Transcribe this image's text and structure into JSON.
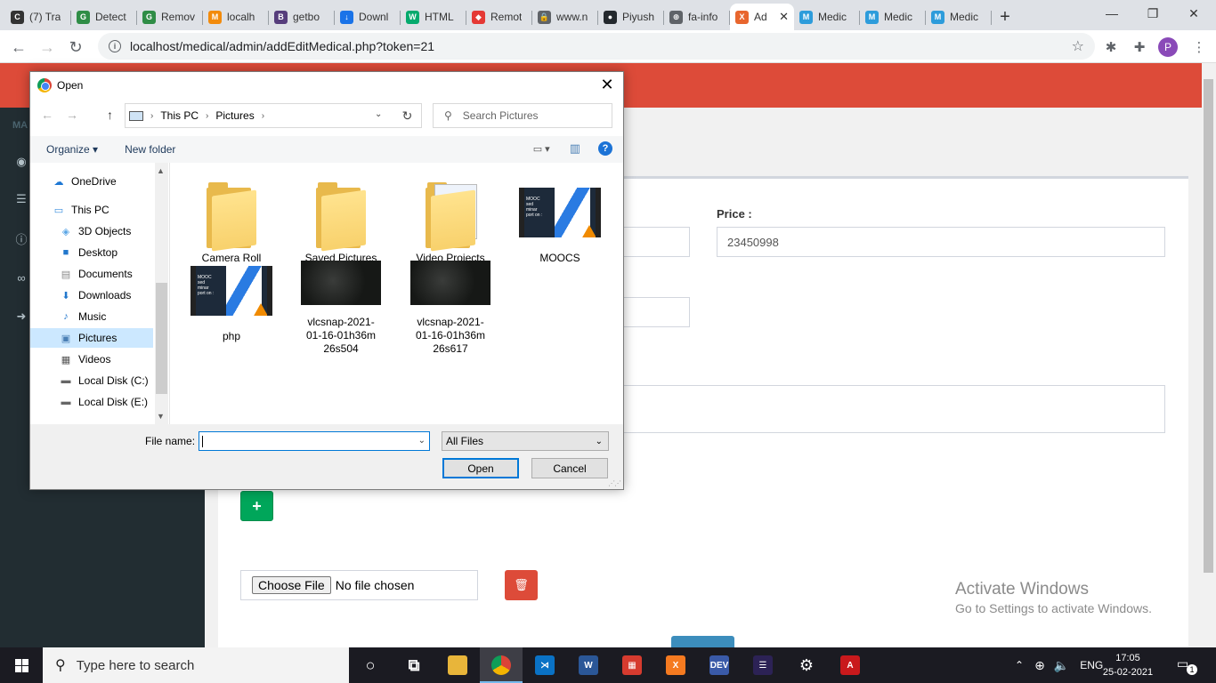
{
  "browser": {
    "tabs": [
      {
        "label": "(7) Tra",
        "color": "#333333",
        "glyph": "C"
      },
      {
        "label": "Detect",
        "color": "#2f8d46",
        "glyph": "G"
      },
      {
        "label": "Remov",
        "color": "#2f8d46",
        "glyph": "G"
      },
      {
        "label": "localh",
        "color": "#f28b0c",
        "glyph": "M"
      },
      {
        "label": "getbo",
        "color": "#563d7c",
        "glyph": "B"
      },
      {
        "label": "Downl",
        "color": "#1a73e8",
        "glyph": "↓"
      },
      {
        "label": "HTML",
        "color": "#04aa6d",
        "glyph": "W"
      },
      {
        "label": "Remot",
        "color": "#e53935",
        "glyph": "◆"
      },
      {
        "label": "www.n",
        "color": "#5f6368",
        "glyph": "🔒"
      },
      {
        "label": "Piyush",
        "color": "#24292e",
        "glyph": "●"
      },
      {
        "label": "fa-info",
        "color": "#5f6368",
        "glyph": "⊕"
      },
      {
        "label": "Ad",
        "color": "#e8662e",
        "glyph": "X",
        "active": true
      },
      {
        "label": "Medic",
        "color": "#2d9cdb",
        "glyph": "M"
      },
      {
        "label": "Medic",
        "color": "#2d9cdb",
        "glyph": "M"
      },
      {
        "label": "Medic",
        "color": "#2d9cdb",
        "glyph": "M"
      }
    ],
    "new_tab": "+",
    "url": "localhost/medical/admin/addEditMedical.php?token=21",
    "profile_initial": "P"
  },
  "page": {
    "sidebar_header": "MA",
    "price_label": "Price :",
    "price_value": "23450998",
    "add_button": "+",
    "choose_file": "Choose File",
    "no_file": "No file chosen",
    "activate_title": "Activate Windows",
    "activate_sub": "Go to Settings to activate Windows."
  },
  "dialog": {
    "title": "Open",
    "breadcrumb": [
      "This PC",
      "Pictures"
    ],
    "search_placeholder": "Search Pictures",
    "organize": "Organize ▾",
    "new_folder": "New folder",
    "help": "?",
    "nav": [
      {
        "label": "OneDrive",
        "icon": "cloud-icon",
        "color": "#1e78d4",
        "indent": 1
      },
      {
        "label": "This PC",
        "icon": "computer-icon",
        "color": "#3a8ede",
        "indent": 1
      },
      {
        "label": "3D Objects",
        "icon": "cube-icon",
        "color": "#5aa6e6",
        "indent": 2
      },
      {
        "label": "Desktop",
        "icon": "desktop-icon",
        "color": "#2277cc",
        "indent": 2
      },
      {
        "label": "Documents",
        "icon": "document-icon",
        "color": "#8a8a8a",
        "indent": 2
      },
      {
        "label": "Downloads",
        "icon": "download-icon",
        "color": "#2277cc",
        "indent": 2
      },
      {
        "label": "Music",
        "icon": "music-icon",
        "color": "#2277cc",
        "indent": 2
      },
      {
        "label": "Pictures",
        "icon": "pictures-icon",
        "color": "#4a7fb5",
        "indent": 2,
        "selected": true
      },
      {
        "label": "Videos",
        "icon": "videos-icon",
        "color": "#555555",
        "indent": 2
      },
      {
        "label": "Local Disk (C:)",
        "icon": "drive-icon",
        "color": "#666666",
        "indent": 2
      },
      {
        "label": "Local Disk (E:)",
        "icon": "drive-icon",
        "color": "#666666",
        "indent": 2
      }
    ],
    "files": [
      {
        "label": "Camera Roll",
        "kind": "folder"
      },
      {
        "label": "Saved Pictures",
        "kind": "folder"
      },
      {
        "label": "Video Projects",
        "kind": "folder-doc"
      },
      {
        "label": "MOOCS",
        "kind": "video"
      },
      {
        "label": "php",
        "kind": "video"
      },
      {
        "label": "vlcsnap-2021-01-16-01h36m26s504",
        "kind": "snap"
      },
      {
        "label": "vlcsnap-2021-01-16-01h36m26s617",
        "kind": "snap"
      }
    ],
    "file_name_label": "File name:",
    "file_name_value": "",
    "file_type": "All Files",
    "open_button": "Open",
    "cancel_button": "Cancel"
  },
  "taskbar": {
    "search_placeholder": "Type here to search",
    "language": "ENG",
    "time": "17:05",
    "date": "25-02-2021",
    "notifications": "1",
    "apps": [
      {
        "name": "cortana-icon",
        "glyph": "○",
        "color": "transparent"
      },
      {
        "name": "task-view-icon",
        "glyph": "⧉",
        "color": "transparent"
      },
      {
        "name": "file-explorer-icon",
        "glyph": "",
        "color": "#e8b53a"
      },
      {
        "name": "chrome-icon",
        "glyph": "",
        "color": "#db4437",
        "active": true
      },
      {
        "name": "vscode-icon",
        "glyph": "⋊",
        "color": "#0a72c5"
      },
      {
        "name": "word-icon",
        "glyph": "W",
        "color": "#2b5797"
      },
      {
        "name": "store-icon",
        "glyph": "▦",
        "color": "#d63b2f"
      },
      {
        "name": "xampp-icon",
        "glyph": "X",
        "color": "#f57a20"
      },
      {
        "name": "devcpp-icon",
        "glyph": "DEV",
        "color": "#3a5aa8"
      },
      {
        "name": "eclipse-icon",
        "glyph": "☰",
        "color": "#2c2255"
      },
      {
        "name": "settings-icon",
        "glyph": "⚙",
        "color": "transparent"
      },
      {
        "name": "acrobat-icon",
        "glyph": "A",
        "color": "#c9191c"
      }
    ]
  }
}
